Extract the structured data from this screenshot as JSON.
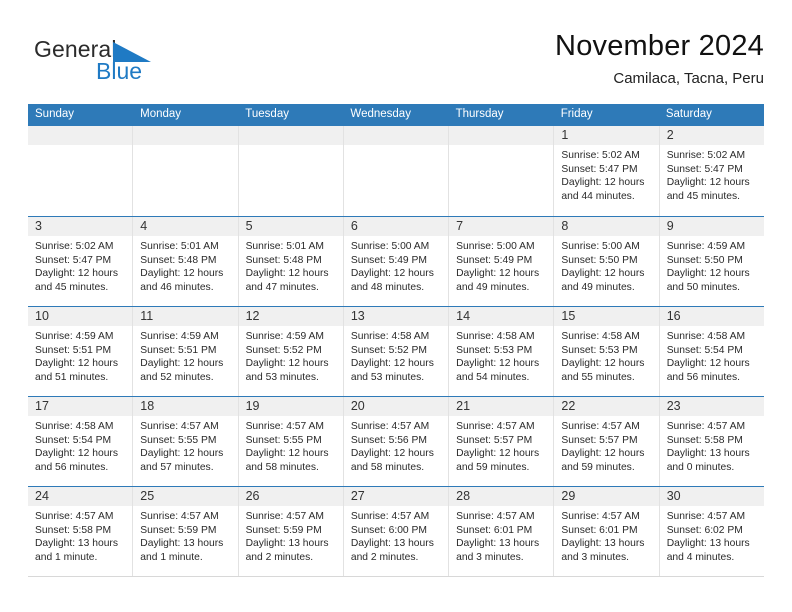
{
  "brand": {
    "name_part1": "General",
    "name_part2": "Blue",
    "triangle_color": "#1f7ac4",
    "blue_color": "#1f7ac4"
  },
  "header": {
    "title": "November 2024",
    "subtitle": "Camilaca, Tacna, Peru"
  },
  "theme": {
    "header_blue": "#2e7ab8",
    "daynum_band": "#f0f0f0",
    "cell_border": "#e2e2e2"
  },
  "weekdays": [
    "Sunday",
    "Monday",
    "Tuesday",
    "Wednesday",
    "Thursday",
    "Friday",
    "Saturday"
  ],
  "weeks": [
    [
      {
        "day": "",
        "sunrise": "",
        "sunset": "",
        "daylight1": "",
        "daylight2": ""
      },
      {
        "day": "",
        "sunrise": "",
        "sunset": "",
        "daylight1": "",
        "daylight2": ""
      },
      {
        "day": "",
        "sunrise": "",
        "sunset": "",
        "daylight1": "",
        "daylight2": ""
      },
      {
        "day": "",
        "sunrise": "",
        "sunset": "",
        "daylight1": "",
        "daylight2": ""
      },
      {
        "day": "",
        "sunrise": "",
        "sunset": "",
        "daylight1": "",
        "daylight2": ""
      },
      {
        "day": "1",
        "sunrise": "Sunrise: 5:02 AM",
        "sunset": "Sunset: 5:47 PM",
        "daylight1": "Daylight: 12 hours",
        "daylight2": "and 44 minutes."
      },
      {
        "day": "2",
        "sunrise": "Sunrise: 5:02 AM",
        "sunset": "Sunset: 5:47 PM",
        "daylight1": "Daylight: 12 hours",
        "daylight2": "and 45 minutes."
      }
    ],
    [
      {
        "day": "3",
        "sunrise": "Sunrise: 5:02 AM",
        "sunset": "Sunset: 5:47 PM",
        "daylight1": "Daylight: 12 hours",
        "daylight2": "and 45 minutes."
      },
      {
        "day": "4",
        "sunrise": "Sunrise: 5:01 AM",
        "sunset": "Sunset: 5:48 PM",
        "daylight1": "Daylight: 12 hours",
        "daylight2": "and 46 minutes."
      },
      {
        "day": "5",
        "sunrise": "Sunrise: 5:01 AM",
        "sunset": "Sunset: 5:48 PM",
        "daylight1": "Daylight: 12 hours",
        "daylight2": "and 47 minutes."
      },
      {
        "day": "6",
        "sunrise": "Sunrise: 5:00 AM",
        "sunset": "Sunset: 5:49 PM",
        "daylight1": "Daylight: 12 hours",
        "daylight2": "and 48 minutes."
      },
      {
        "day": "7",
        "sunrise": "Sunrise: 5:00 AM",
        "sunset": "Sunset: 5:49 PM",
        "daylight1": "Daylight: 12 hours",
        "daylight2": "and 49 minutes."
      },
      {
        "day": "8",
        "sunrise": "Sunrise: 5:00 AM",
        "sunset": "Sunset: 5:50 PM",
        "daylight1": "Daylight: 12 hours",
        "daylight2": "and 49 minutes."
      },
      {
        "day": "9",
        "sunrise": "Sunrise: 4:59 AM",
        "sunset": "Sunset: 5:50 PM",
        "daylight1": "Daylight: 12 hours",
        "daylight2": "and 50 minutes."
      }
    ],
    [
      {
        "day": "10",
        "sunrise": "Sunrise: 4:59 AM",
        "sunset": "Sunset: 5:51 PM",
        "daylight1": "Daylight: 12 hours",
        "daylight2": "and 51 minutes."
      },
      {
        "day": "11",
        "sunrise": "Sunrise: 4:59 AM",
        "sunset": "Sunset: 5:51 PM",
        "daylight1": "Daylight: 12 hours",
        "daylight2": "and 52 minutes."
      },
      {
        "day": "12",
        "sunrise": "Sunrise: 4:59 AM",
        "sunset": "Sunset: 5:52 PM",
        "daylight1": "Daylight: 12 hours",
        "daylight2": "and 53 minutes."
      },
      {
        "day": "13",
        "sunrise": "Sunrise: 4:58 AM",
        "sunset": "Sunset: 5:52 PM",
        "daylight1": "Daylight: 12 hours",
        "daylight2": "and 53 minutes."
      },
      {
        "day": "14",
        "sunrise": "Sunrise: 4:58 AM",
        "sunset": "Sunset: 5:53 PM",
        "daylight1": "Daylight: 12 hours",
        "daylight2": "and 54 minutes."
      },
      {
        "day": "15",
        "sunrise": "Sunrise: 4:58 AM",
        "sunset": "Sunset: 5:53 PM",
        "daylight1": "Daylight: 12 hours",
        "daylight2": "and 55 minutes."
      },
      {
        "day": "16",
        "sunrise": "Sunrise: 4:58 AM",
        "sunset": "Sunset: 5:54 PM",
        "daylight1": "Daylight: 12 hours",
        "daylight2": "and 56 minutes."
      }
    ],
    [
      {
        "day": "17",
        "sunrise": "Sunrise: 4:58 AM",
        "sunset": "Sunset: 5:54 PM",
        "daylight1": "Daylight: 12 hours",
        "daylight2": "and 56 minutes."
      },
      {
        "day": "18",
        "sunrise": "Sunrise: 4:57 AM",
        "sunset": "Sunset: 5:55 PM",
        "daylight1": "Daylight: 12 hours",
        "daylight2": "and 57 minutes."
      },
      {
        "day": "19",
        "sunrise": "Sunrise: 4:57 AM",
        "sunset": "Sunset: 5:55 PM",
        "daylight1": "Daylight: 12 hours",
        "daylight2": "and 58 minutes."
      },
      {
        "day": "20",
        "sunrise": "Sunrise: 4:57 AM",
        "sunset": "Sunset: 5:56 PM",
        "daylight1": "Daylight: 12 hours",
        "daylight2": "and 58 minutes."
      },
      {
        "day": "21",
        "sunrise": "Sunrise: 4:57 AM",
        "sunset": "Sunset: 5:57 PM",
        "daylight1": "Daylight: 12 hours",
        "daylight2": "and 59 minutes."
      },
      {
        "day": "22",
        "sunrise": "Sunrise: 4:57 AM",
        "sunset": "Sunset: 5:57 PM",
        "daylight1": "Daylight: 12 hours",
        "daylight2": "and 59 minutes."
      },
      {
        "day": "23",
        "sunrise": "Sunrise: 4:57 AM",
        "sunset": "Sunset: 5:58 PM",
        "daylight1": "Daylight: 13 hours",
        "daylight2": "and 0 minutes."
      }
    ],
    [
      {
        "day": "24",
        "sunrise": "Sunrise: 4:57 AM",
        "sunset": "Sunset: 5:58 PM",
        "daylight1": "Daylight: 13 hours",
        "daylight2": "and 1 minute."
      },
      {
        "day": "25",
        "sunrise": "Sunrise: 4:57 AM",
        "sunset": "Sunset: 5:59 PM",
        "daylight1": "Daylight: 13 hours",
        "daylight2": "and 1 minute."
      },
      {
        "day": "26",
        "sunrise": "Sunrise: 4:57 AM",
        "sunset": "Sunset: 5:59 PM",
        "daylight1": "Daylight: 13 hours",
        "daylight2": "and 2 minutes."
      },
      {
        "day": "27",
        "sunrise": "Sunrise: 4:57 AM",
        "sunset": "Sunset: 6:00 PM",
        "daylight1": "Daylight: 13 hours",
        "daylight2": "and 2 minutes."
      },
      {
        "day": "28",
        "sunrise": "Sunrise: 4:57 AM",
        "sunset": "Sunset: 6:01 PM",
        "daylight1": "Daylight: 13 hours",
        "daylight2": "and 3 minutes."
      },
      {
        "day": "29",
        "sunrise": "Sunrise: 4:57 AM",
        "sunset": "Sunset: 6:01 PM",
        "daylight1": "Daylight: 13 hours",
        "daylight2": "and 3 minutes."
      },
      {
        "day": "30",
        "sunrise": "Sunrise: 4:57 AM",
        "sunset": "Sunset: 6:02 PM",
        "daylight1": "Daylight: 13 hours",
        "daylight2": "and 4 minutes."
      }
    ]
  ]
}
